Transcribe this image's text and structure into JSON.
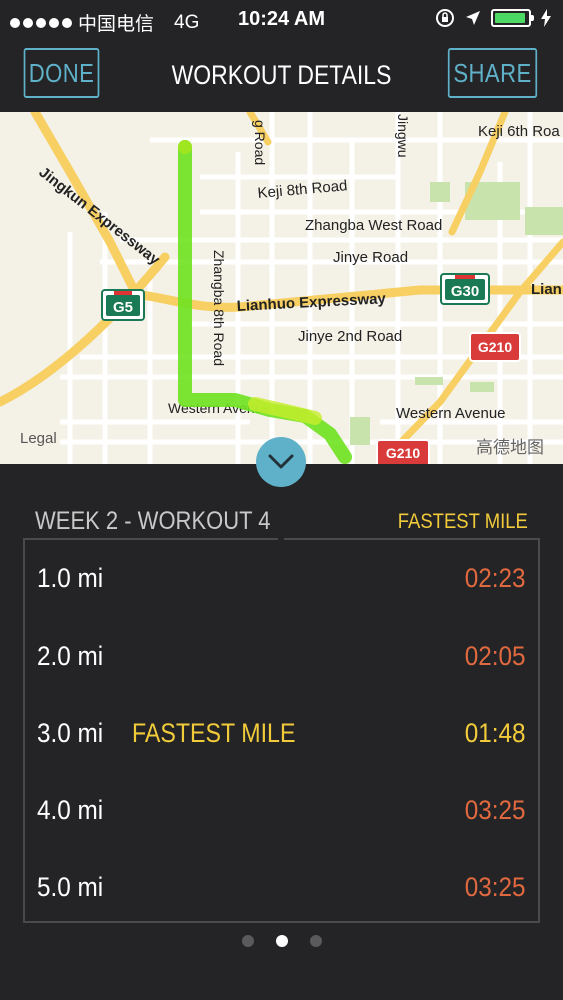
{
  "status_bar": {
    "carrier": "中国电信",
    "network": "4G",
    "time": "10:24 AM"
  },
  "nav": {
    "done_label": "DONE",
    "title": "WORKOUT DETAILS",
    "share_label": "SHARE"
  },
  "map": {
    "labels": {
      "jingkun": "Jingkun Expressway",
      "g5": "G5",
      "zhangba8": "Zhangba 8th Road",
      "keji8": "Keji 8th Road",
      "keji6": "Keji 6th Roa",
      "zhangbawest": "Zhangba West Road",
      "jinye": "Jinye Road",
      "lianhuo": "Lianhuo Expressway",
      "g30": "G30",
      "lian": "Lian",
      "jinye2": "Jinye 2nd Road",
      "g210a": "G210",
      "g210b": "G210",
      "western1": "Western Avenue",
      "western2": "Western Avenue",
      "legal": "Legal",
      "gaode": "高德地图",
      "jingwu": "Jingwu",
      "groad": "g Road"
    }
  },
  "summary": {
    "week": "WEEK 2 - WORKOUT 4",
    "fastest_label": "FASTEST MILE"
  },
  "splits": [
    {
      "distance": "1.0  mi",
      "time": "02:23",
      "tag": ""
    },
    {
      "distance": "2.0  mi",
      "time": "02:05",
      "tag": ""
    },
    {
      "distance": "3.0  mi",
      "time": "01:48",
      "tag": "FASTEST MILE"
    },
    {
      "distance": "4.0  mi",
      "time": "03:25",
      "tag": ""
    },
    {
      "distance": "5.0  mi",
      "time": "03:25",
      "tag": ""
    }
  ],
  "pager": {
    "count": 3,
    "active": 2
  },
  "colors": {
    "accent": "#5fb1c9",
    "fastest": "#f2cb3b",
    "split_time": "#e1693f",
    "route": "#6ee21f",
    "background": "#242426"
  }
}
